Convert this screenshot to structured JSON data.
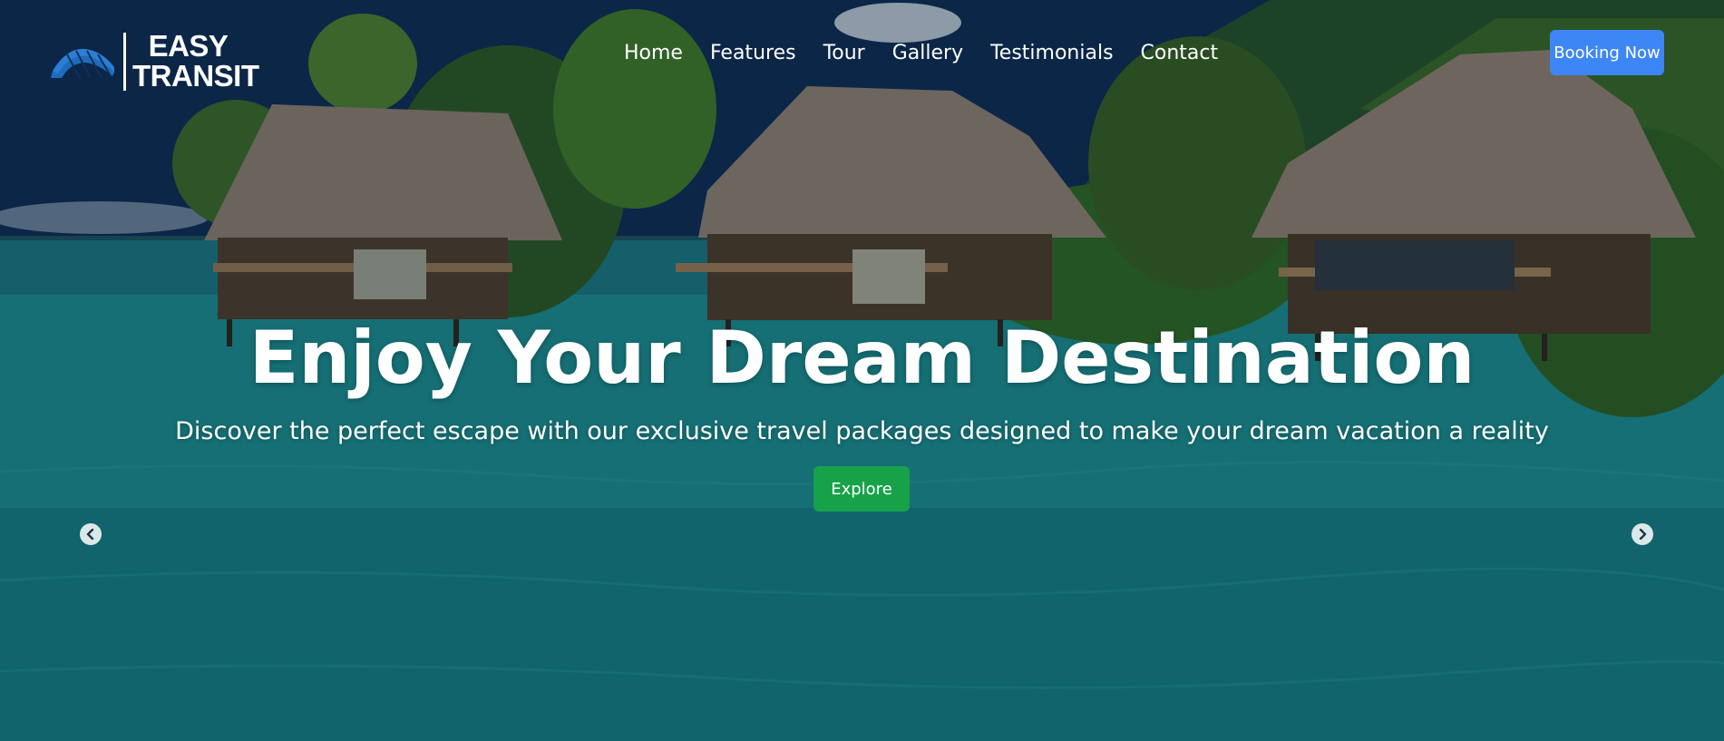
{
  "brand": {
    "line1": "EASY",
    "line2": "TRANSIT",
    "logo_icon": "wave-stripes-logo"
  },
  "nav": {
    "items": [
      {
        "label": "Home"
      },
      {
        "label": "Features"
      },
      {
        "label": "Tour"
      },
      {
        "label": "Gallery"
      },
      {
        "label": "Testimonials"
      },
      {
        "label": "Contact"
      }
    ]
  },
  "header": {
    "cta_label": "Booking Now"
  },
  "hero": {
    "title": "Enjoy Your Dream Destination",
    "subtitle": "Discover the perfect escape with our exclusive travel packages designed to make your dream vacation a reality",
    "button_label": "Explore",
    "prev_icon": "chevron-left-icon",
    "next_icon": "chevron-right-icon"
  },
  "colors": {
    "primary_button": "#3d86f5",
    "explore_button": "#17a24a",
    "logo_blue": "#2a7fd4",
    "text": "#ffffff"
  }
}
